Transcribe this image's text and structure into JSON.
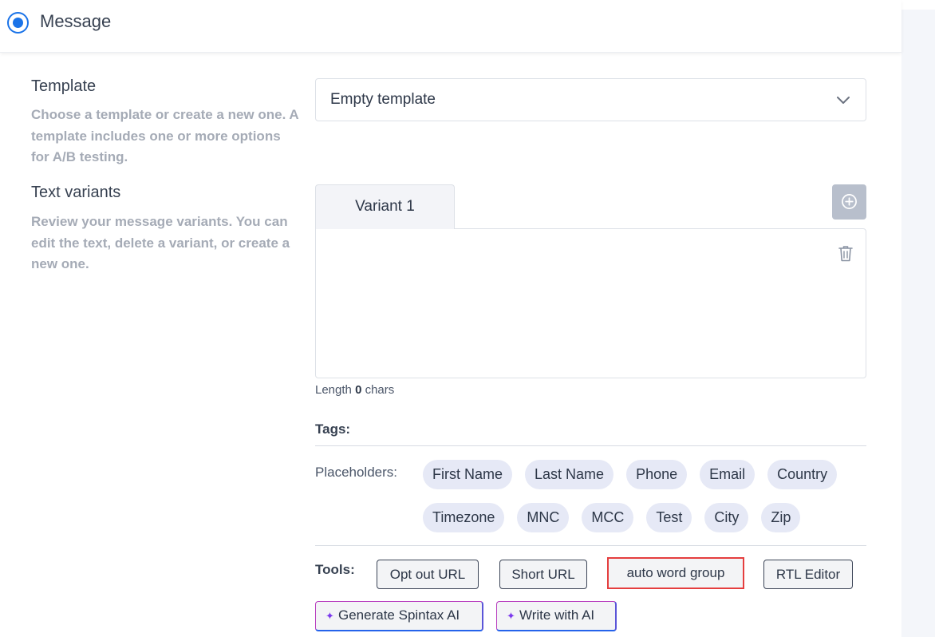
{
  "header": {
    "title": "Message"
  },
  "template": {
    "label": "Template",
    "description": "Choose a template or create a new one. A template includes one or more options for A/B testing.",
    "selected": "Empty template"
  },
  "variants": {
    "label": "Text variants",
    "description": "Review your message variants. You can edit the text, delete a variant, or create a new one.",
    "tab_label": "Variant 1",
    "length_prefix": "Length",
    "length_value": "0",
    "length_suffix": "chars"
  },
  "tags": {
    "title": "Tags:",
    "placeholders_label": "Placeholders:",
    "placeholders": [
      "First Name",
      "Last Name",
      "Phone",
      "Email",
      "Country",
      "Timezone",
      "MNC",
      "MCC",
      "Test",
      "City",
      "Zip"
    ]
  },
  "tools": {
    "label": "Tools:",
    "opt_out_url": "Opt out URL",
    "short_url": "Short URL",
    "auto_word_group": "auto word group",
    "rtl_editor": "RTL Editor",
    "generate_spintax_ai": "Generate Spintax AI",
    "write_with_ai": "Write with AI"
  },
  "colors": {
    "accent": "#1a73e8",
    "highlight_border": "#e53e3e",
    "chip_bg": "#e6e9f6",
    "add_button_bg": "#b8bfcc"
  }
}
